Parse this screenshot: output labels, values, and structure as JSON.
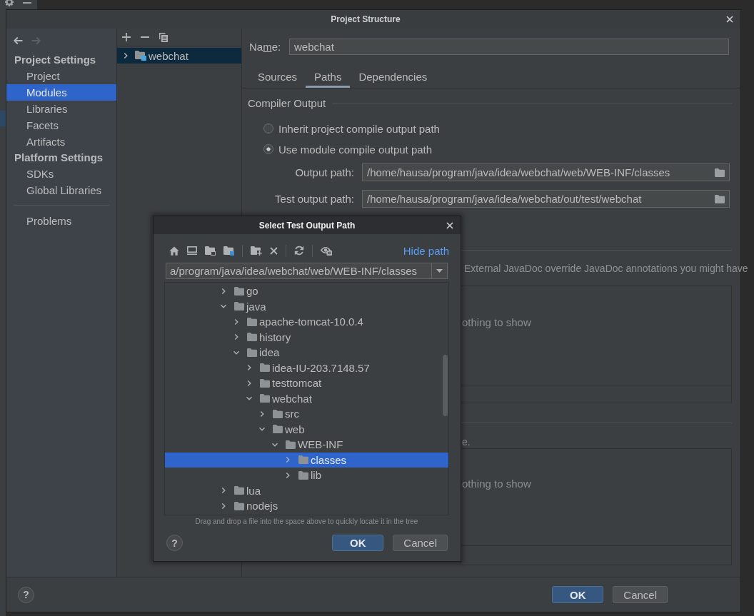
{
  "window": {
    "title": "Project Structure"
  },
  "sidebar": {
    "navigation": [
      {
        "kind": "back",
        "disabled": false
      },
      {
        "kind": "forward",
        "disabled": true
      }
    ],
    "sections": [
      {
        "title": "Project Settings",
        "items": [
          {
            "label": "Project",
            "selected": false
          },
          {
            "label": "Modules",
            "selected": true
          },
          {
            "label": "Libraries",
            "selected": false
          },
          {
            "label": "Facets",
            "selected": false
          },
          {
            "label": "Artifacts",
            "selected": false
          }
        ]
      },
      {
        "title": "Platform Settings",
        "items": [
          {
            "label": "SDKs",
            "selected": false
          },
          {
            "label": "Global Libraries",
            "selected": false
          }
        ]
      }
    ],
    "footer_items": [
      {
        "label": "Problems",
        "selected": false
      }
    ]
  },
  "modules": {
    "items": [
      {
        "label": "webchat",
        "expanded": false,
        "selected": true
      }
    ]
  },
  "module_settings": {
    "name": {
      "label": {
        "before": "Na",
        "mnemonic": "m",
        "after": "e:"
      },
      "value": "webchat"
    },
    "tabs": [
      {
        "label": "Sources",
        "selected": false
      },
      {
        "label": "Paths",
        "selected": true
      },
      {
        "label": "Dependencies",
        "selected": false
      }
    ],
    "compiler_output": {
      "title": "Compiler Output",
      "options": [
        {
          "label": "Inherit project compile output path",
          "selected": false
        },
        {
          "label": "Use module compile output path",
          "selected": true
        }
      ],
      "paths": [
        {
          "label": "Output path:",
          "value": "/home/hausa/program/java/idea/webchat/web/WEB-INF/classes"
        },
        {
          "label": "Test output path:",
          "value": "/home/hausa/program/java/idea/webchat/out/test/webchat"
        }
      ]
    },
    "lower_sections": [
      {
        "description": "External JavaDoc override JavaDoc annotations you might have",
        "empty_text": "othing to show"
      },
      {
        "description": "e.",
        "empty_text": "othing to show"
      }
    ]
  },
  "footer": {
    "help": "?",
    "buttons": [
      {
        "label": "OK",
        "kind": "primary"
      },
      {
        "label": "Cancel",
        "kind": "secondary"
      }
    ]
  },
  "dialog": {
    "title": "Select Test Output Path",
    "hide_path_link": "Hide path",
    "path": "a/program/java/idea/webchat/web/WEB-INF/classes",
    "tree": [
      {
        "label": "go",
        "expanded": false,
        "selected": false
      },
      {
        "label": "java",
        "expanded": true,
        "selected": false,
        "children": [
          {
            "label": "apache-tomcat-10.0.4",
            "expanded": false,
            "selected": false
          },
          {
            "label": "history",
            "expanded": false,
            "selected": false
          },
          {
            "label": "idea",
            "expanded": true,
            "selected": false,
            "children": [
              {
                "label": "idea-IU-203.7148.57",
                "expanded": false,
                "selected": false
              },
              {
                "label": "testtomcat",
                "expanded": false,
                "selected": false
              },
              {
                "label": "webchat",
                "expanded": true,
                "selected": false,
                "children": [
                  {
                    "label": "src",
                    "expanded": false,
                    "selected": false
                  },
                  {
                    "label": "web",
                    "expanded": true,
                    "selected": false,
                    "children": [
                      {
                        "label": "WEB-INF",
                        "expanded": true,
                        "selected": false,
                        "children": [
                          {
                            "label": "classes",
                            "expanded": false,
                            "selected": true
                          },
                          {
                            "label": "lib",
                            "expanded": false,
                            "selected": false
                          }
                        ]
                      }
                    ]
                  }
                ]
              }
            ]
          }
        ]
      },
      {
        "label": "lua",
        "expanded": false,
        "selected": false
      },
      {
        "label": "nodejs",
        "expanded": false,
        "selected": false
      }
    ],
    "hint": "Drag and drop a file into the space above to quickly locate it in the tree",
    "help": "?",
    "buttons": [
      {
        "label": "OK",
        "kind": "primary"
      },
      {
        "label": "Cancel",
        "kind": "secondary"
      }
    ]
  }
}
